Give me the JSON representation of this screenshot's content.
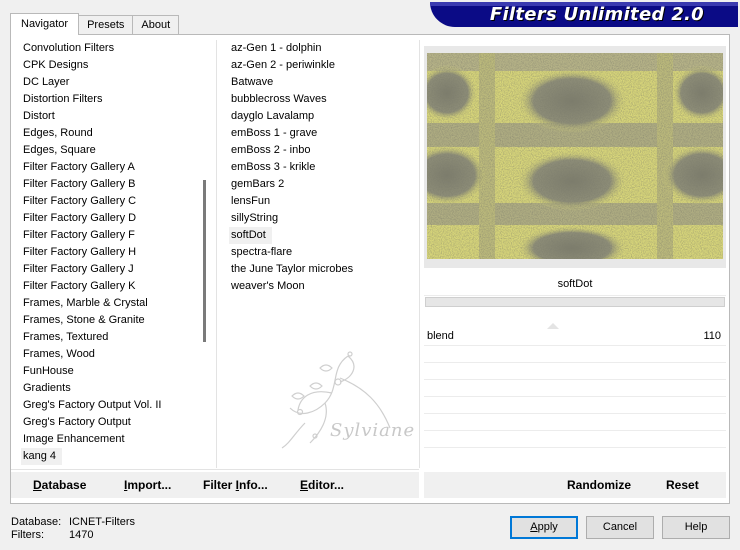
{
  "tabs": [
    {
      "label": "Navigator",
      "active": true
    },
    {
      "label": "Presets",
      "active": false
    },
    {
      "label": "About",
      "active": false
    }
  ],
  "banner": {
    "title": "Filters Unlimited 2.0"
  },
  "categories": [
    "Convolution Filters",
    "CPK Designs",
    "DC Layer",
    "Distortion Filters",
    "Distort",
    "Edges, Round",
    "Edges, Square",
    "Filter Factory Gallery A",
    "Filter Factory Gallery B",
    "Filter Factory Gallery C",
    "Filter Factory Gallery D",
    "Filter Factory Gallery F",
    "Filter Factory Gallery H",
    "Filter Factory Gallery J",
    "Filter Factory Gallery K",
    "Frames, Marble & Crystal",
    "Frames, Stone & Granite",
    "Frames, Textured",
    "Frames, Wood",
    "FunHouse",
    "Gradients",
    "Greg's Factory Output Vol. II",
    "Greg's Factory Output",
    "Image Enhancement",
    "kang 4"
  ],
  "selected_category": "kang 4",
  "filters": [
    "az-Gen 1  -  dolphin",
    "az-Gen 2  -  periwinkle",
    "Batwave",
    "bubblecross Waves",
    "dayglo Lavalamp",
    "emBoss 1  -  grave",
    "emBoss 2  -  inbo",
    "emBoss 3  -  krikle",
    "gemBars 2",
    "lensFun",
    "sillyString",
    "softDot",
    "spectra-flare",
    "the June Taylor microbes",
    "weaver's Moon"
  ],
  "selected_filter": "softDot",
  "watermark": {
    "text": "Sylviane"
  },
  "settings": {
    "filter_name": "softDot",
    "params": [
      {
        "label": "blend",
        "value": "110",
        "level": 0.43
      }
    ],
    "empty_rows": 6
  },
  "panel_buttons": {
    "database": {
      "ul": "D",
      "rest": "atabase"
    },
    "import": {
      "ul": "I",
      "rest": "mport..."
    },
    "filter_info": {
      "pre": "Filter ",
      "ul": "I",
      "rest": "nfo..."
    },
    "editor": {
      "ul": "E",
      "rest": "ditor..."
    },
    "randomize": "Randomize",
    "reset": "Reset"
  },
  "footer": {
    "database_label": "Database:",
    "database_value": "ICNET-Filters",
    "filters_label": "Filters:",
    "filters_value": "1470"
  },
  "dialog_buttons": {
    "apply": {
      "ul": "A",
      "rest": "pply"
    },
    "cancel": "Cancel",
    "help": "Help"
  },
  "colors": {
    "banner": "#0b0b86",
    "preview_yellow": "#d9d77a",
    "preview_gray": "#8a8a78",
    "default_button_border": "#0078d7"
  }
}
